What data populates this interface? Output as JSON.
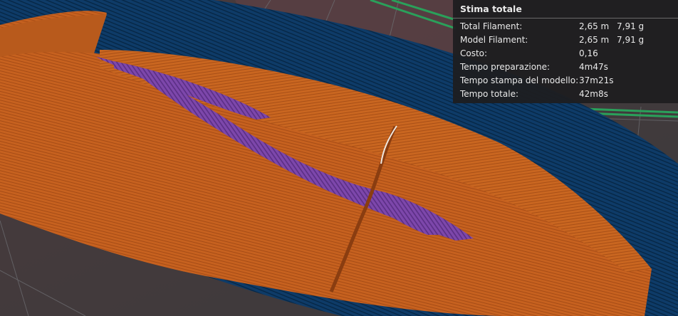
{
  "summary": {
    "title": "Stima totale",
    "rows": [
      {
        "label": "Total Filament:",
        "length": "2,65 m",
        "weight": "7,91 g"
      },
      {
        "label": "Model Filament:",
        "length": "2,65 m",
        "weight": "7,91 g"
      },
      {
        "label": "Costo:",
        "length": "0,16",
        "weight": ""
      },
      {
        "label": "Tempo preparazione:",
        "length": "4m47s",
        "weight": ""
      },
      {
        "label": "Tempo stampa del modello:",
        "length": "37m21s",
        "weight": ""
      },
      {
        "label": "Tempo totale:",
        "length": "42m8s",
        "weight": ""
      }
    ]
  },
  "colors": {
    "wall": "#c4601f",
    "infill": "#7a45a8",
    "skirt": "#0d3a66",
    "travel": "#2aa05a",
    "background": "#3a3a3c"
  }
}
